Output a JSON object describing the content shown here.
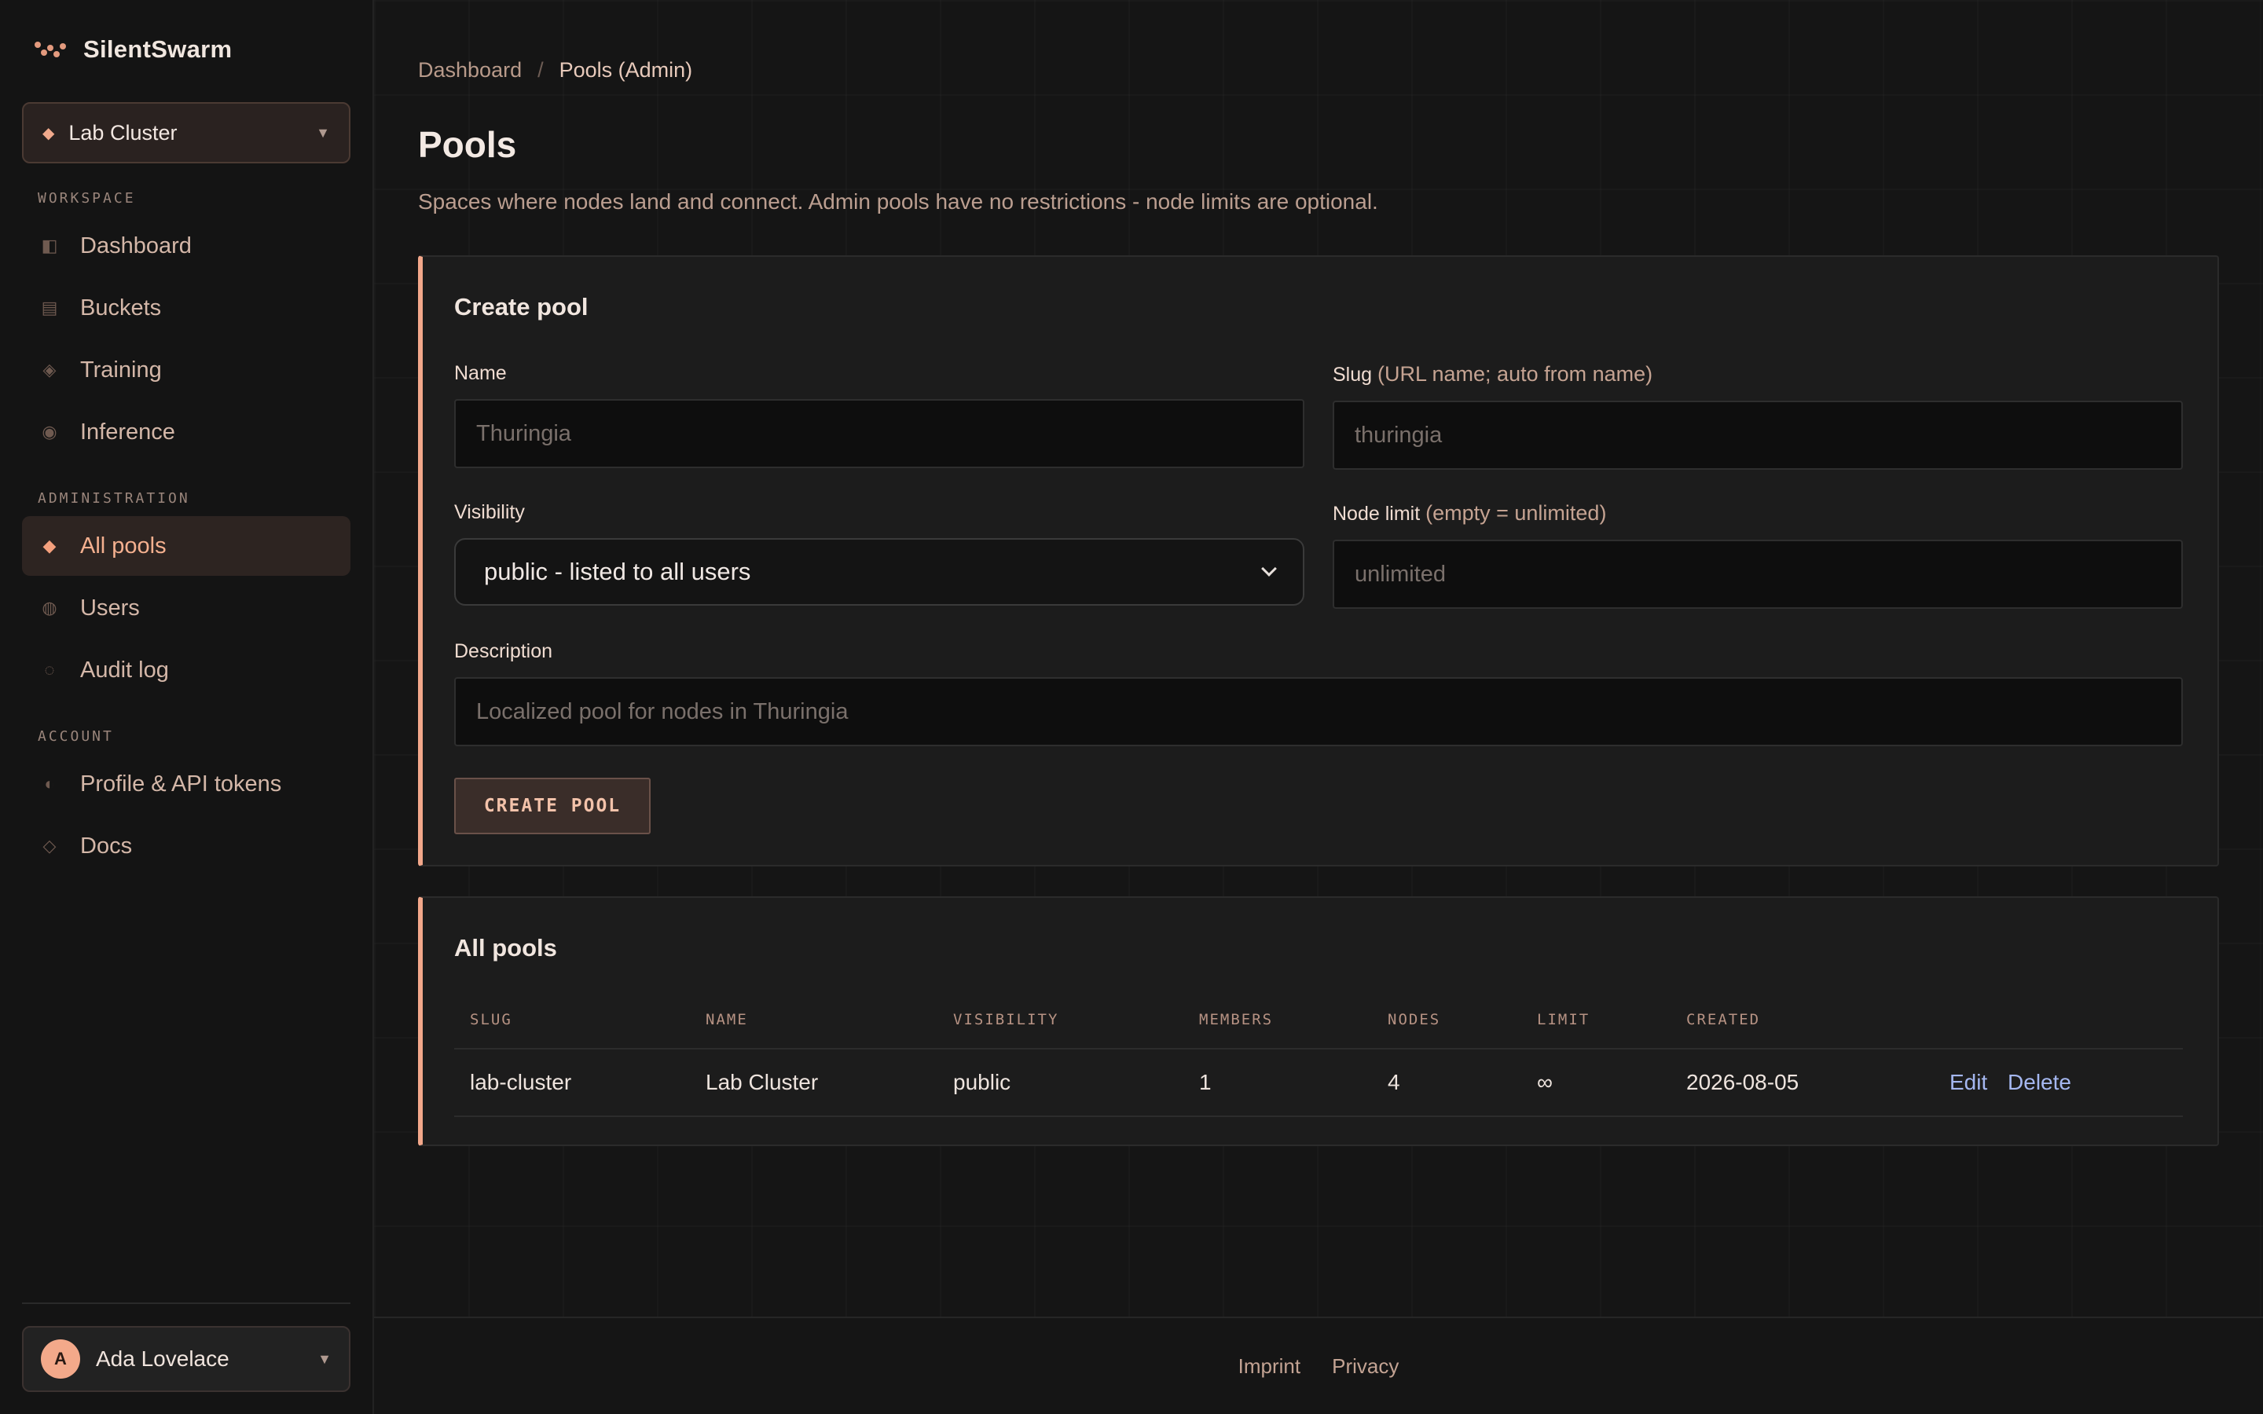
{
  "app": {
    "name": "SilentSwarm"
  },
  "cluster_selector": {
    "value": "Lab Cluster"
  },
  "sidebar": {
    "sections": {
      "workspace": "WORKSPACE",
      "administration": "ADMINISTRATION",
      "account": "ACCOUNT"
    },
    "workspace_items": [
      {
        "label": "Dashboard",
        "icon": "dashboard-icon"
      },
      {
        "label": "Buckets",
        "icon": "buckets-icon"
      },
      {
        "label": "Training",
        "icon": "training-icon"
      },
      {
        "label": "Inference",
        "icon": "inference-icon"
      }
    ],
    "admin_items": [
      {
        "label": "All pools",
        "icon": "pools-icon",
        "active": true
      },
      {
        "label": "Users",
        "icon": "users-icon"
      },
      {
        "label": "Audit log",
        "icon": "audit-log-icon"
      }
    ],
    "account_items": [
      {
        "label": "Profile & API tokens",
        "icon": "profile-icon"
      },
      {
        "label": "Docs",
        "icon": "docs-icon"
      }
    ]
  },
  "user": {
    "initial": "A",
    "name": "Ada Lovelace"
  },
  "breadcrumb": {
    "home": "Dashboard",
    "separator": "/",
    "current": "Pools (Admin)"
  },
  "page": {
    "title": "Pools",
    "subtitle": "Spaces where nodes land and connect. Admin pools have no restrictions - node limits are optional."
  },
  "create_form": {
    "title": "Create pool",
    "name_label": "Name",
    "name_placeholder": "Thuringia",
    "slug_label": "Slug",
    "slug_hint": "(URL name; auto from name)",
    "slug_placeholder": "thuringia",
    "visibility_label": "Visibility",
    "visibility_value": "public - listed to all users",
    "node_limit_label": "Node limit",
    "node_limit_hint": "(empty = unlimited)",
    "node_limit_placeholder": "unlimited",
    "description_label": "Description",
    "description_placeholder": "Localized pool for nodes in Thuringia",
    "submit_label": "CREATE POOL"
  },
  "pools_table": {
    "title": "All pools",
    "columns": [
      "SLUG",
      "NAME",
      "VISIBILITY",
      "MEMBERS",
      "NODES",
      "LIMIT",
      "CREATED"
    ],
    "rows": [
      {
        "slug": "lab-cluster",
        "name": "Lab Cluster",
        "visibility": "public",
        "members": "1",
        "nodes": "4",
        "limit": "∞",
        "created": "2026-08-05",
        "edit": "Edit",
        "delete": "Delete"
      }
    ]
  },
  "footer": {
    "imprint": "Imprint",
    "privacy": "Privacy"
  },
  "colors": {
    "accent": "#f2a78a",
    "link": "#a5b7f0",
    "background": "#151515"
  }
}
